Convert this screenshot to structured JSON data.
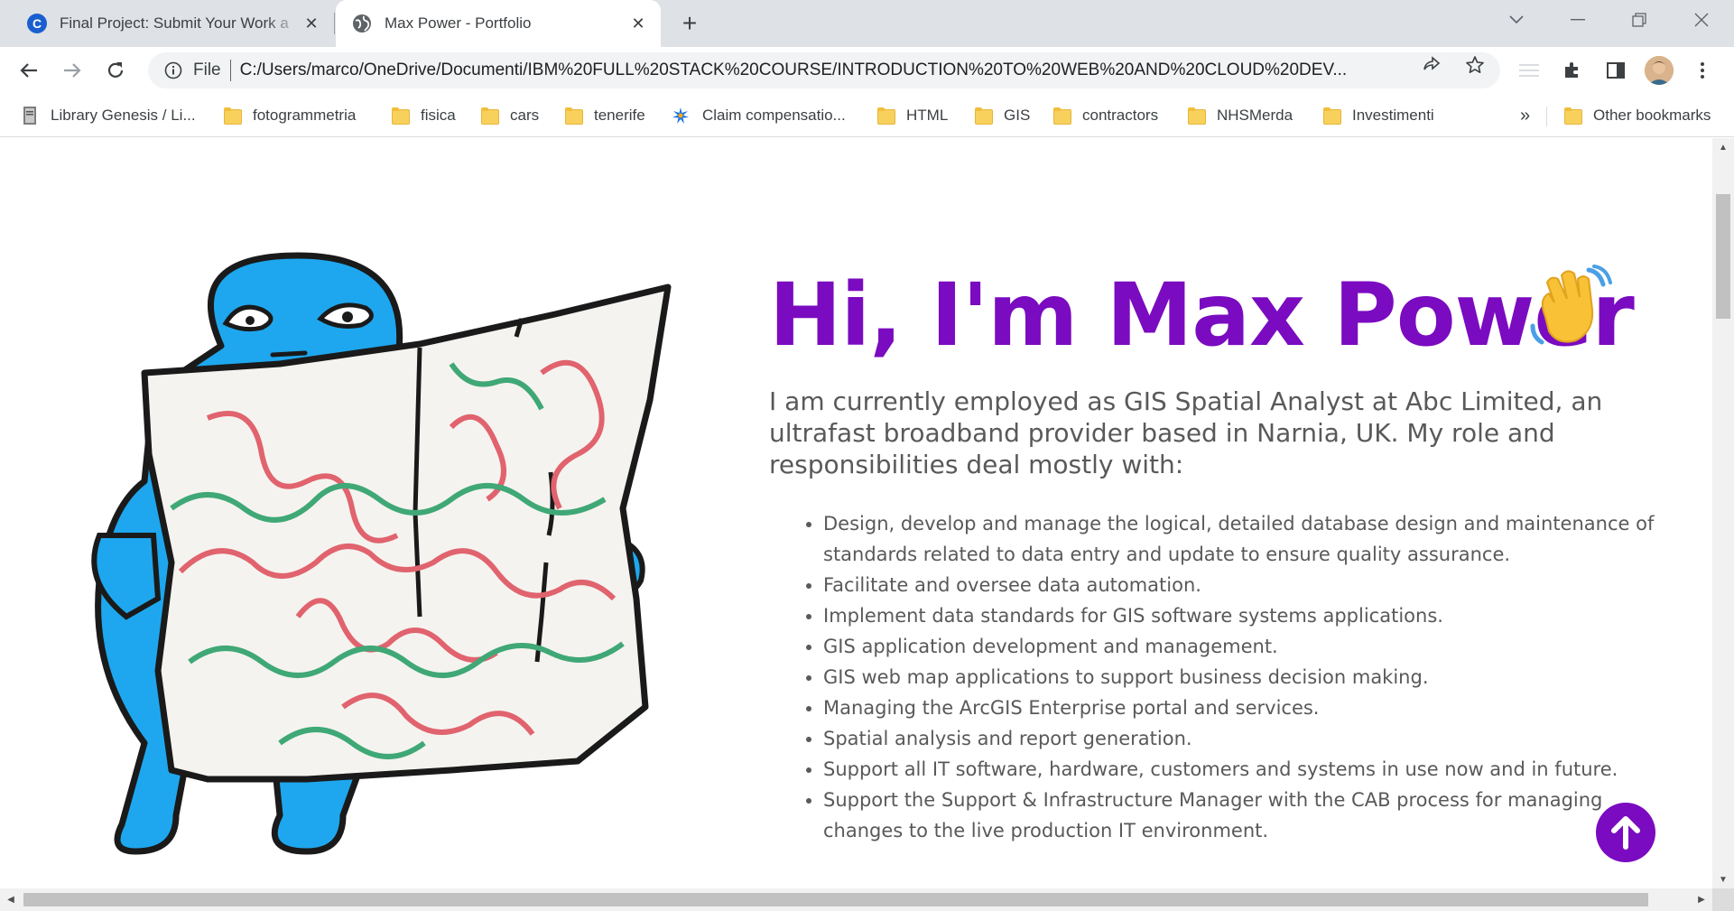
{
  "tabs": [
    {
      "title": "Final Project: Submit Your Work a",
      "favicon": "coursera-icon",
      "active": false
    },
    {
      "title": "Max Power - Portfolio",
      "favicon": "globe-icon",
      "active": true
    }
  ],
  "address_bar": {
    "scheme": "File",
    "url": "C:/Users/marco/OneDrive/Documenti/IBM%20FULL%20STACK%20COURSE/INTRODUCTION%20TO%20WEB%20AND%20CLOUD%20DEV..."
  },
  "bookmarks": [
    {
      "label": "Library Genesis / Li...",
      "icon": "book-icon"
    },
    {
      "label": "fotogrammetria",
      "icon": "folder-icon"
    },
    {
      "label": "fisica",
      "icon": "folder-icon"
    },
    {
      "label": "cars",
      "icon": "folder-icon"
    },
    {
      "label": "tenerife",
      "icon": "folder-icon"
    },
    {
      "label": "Claim compensatio...",
      "icon": "star-burst-icon"
    },
    {
      "label": "HTML",
      "icon": "folder-icon"
    },
    {
      "label": "GIS",
      "icon": "folder-icon"
    },
    {
      "label": "contractors",
      "icon": "folder-icon"
    },
    {
      "label": "NHSMerda",
      "icon": "folder-icon"
    },
    {
      "label": "Investimenti",
      "icon": "folder-icon"
    }
  ],
  "bookmarks_overflow": "»",
  "other_bookmarks": "Other bookmarks",
  "hero": {
    "title": "Hi, I'm Max Power",
    "intro": "I am currently employed as GIS Spatial Analyst at Abc Limited, an ultrafast broadband provider based in Narnia, UK. My role and responsibilities deal mostly with:",
    "duties": [
      "Design, develop and manage the logical, detailed database design and maintenance of standards related to data entry and update to ensure quality assurance.",
      "Facilitate and oversee data automation.",
      "Implement data standards for GIS software systems applications.",
      "GIS application development and management.",
      "GIS web map applications to support business decision making.",
      "Managing the ArcGIS Enterprise portal and services.",
      "Spatial analysis and report generation.",
      "Support all IT software, hardware, customers and systems in use now and in future.",
      "Support the Support & Infrastructure Manager with the CAB process for managing changes to the live production IT environment."
    ]
  },
  "colors": {
    "accent": "#7a0bc0",
    "body_text": "#595959",
    "character_blue": "#1ea7ee"
  }
}
